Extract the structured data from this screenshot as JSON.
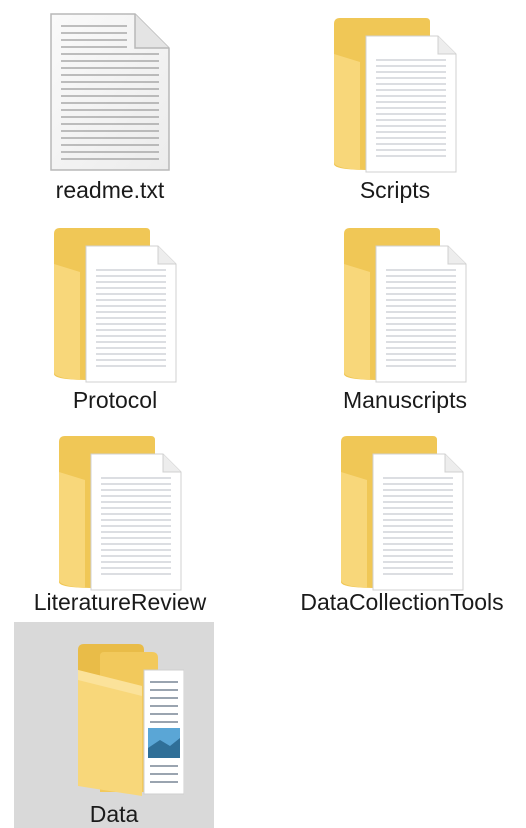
{
  "items": [
    {
      "label": "readme.txt",
      "kind": "text-file",
      "icon": "text-file-icon"
    },
    {
      "label": "Scripts",
      "kind": "folder",
      "icon": "folder-icon"
    },
    {
      "label": "Protocol",
      "kind": "folder",
      "icon": "folder-icon"
    },
    {
      "label": "Manuscripts",
      "kind": "folder",
      "icon": "folder-icon"
    },
    {
      "label": "LiteratureReview",
      "kind": "folder",
      "icon": "folder-icon"
    },
    {
      "label": "DataCollectionTools",
      "kind": "folder",
      "icon": "folder-icon"
    },
    {
      "label": "Data",
      "kind": "folder-open",
      "icon": "folder-with-image-icon",
      "selected": true
    }
  ],
  "colors": {
    "folder_back": "#f0c756",
    "folder_front": "#f8d77a",
    "selection": "#d9d9d9",
    "label": "#1a1a1a"
  }
}
